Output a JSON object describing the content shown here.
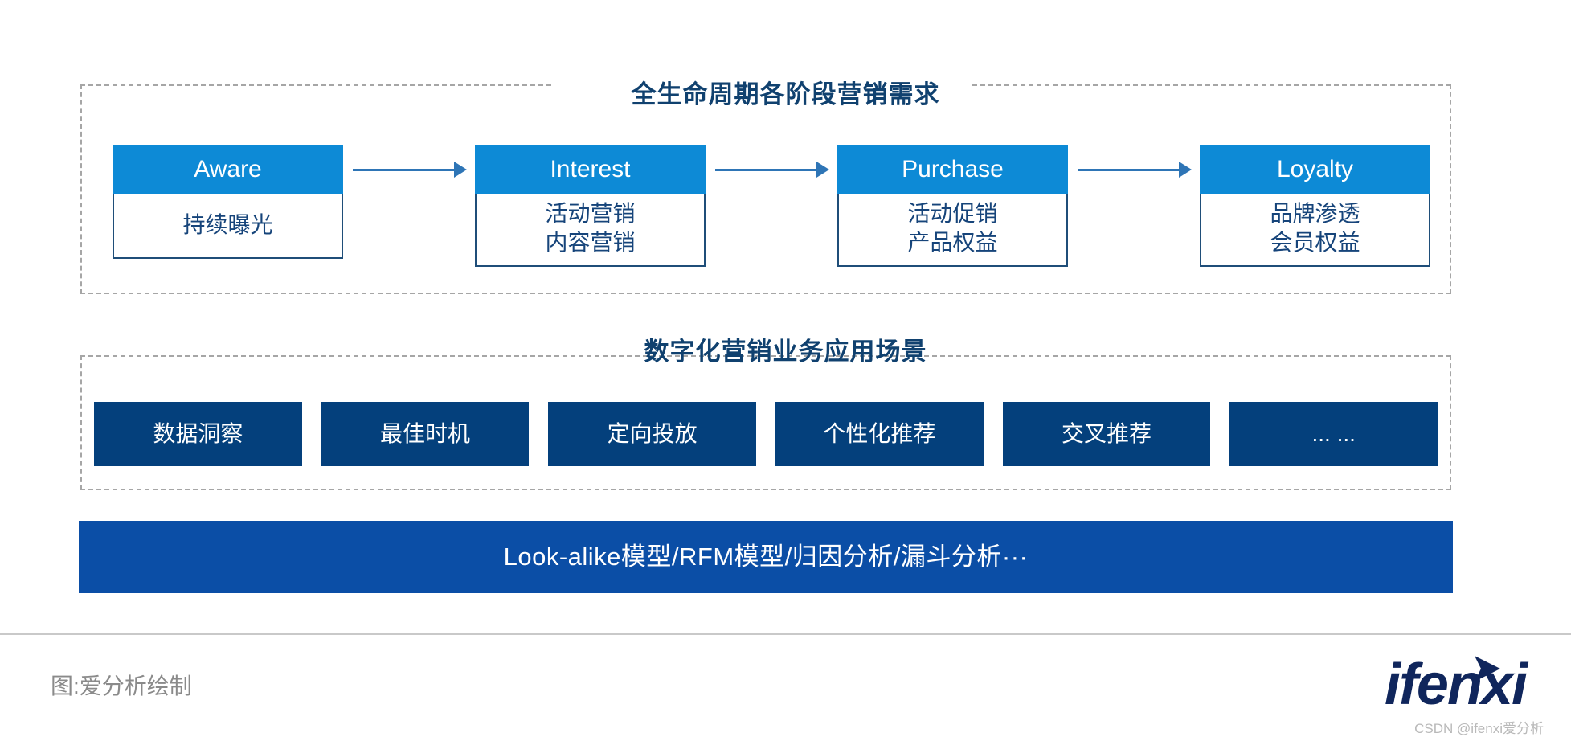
{
  "lifecycle": {
    "title": "全生命周期各阶段营销需求",
    "stages": [
      {
        "name": "Aware",
        "details": [
          "持续曝光"
        ]
      },
      {
        "name": "Interest",
        "details": [
          "活动营销",
          "内容营销"
        ]
      },
      {
        "name": "Purchase",
        "details": [
          "活动促销",
          "产品权益"
        ]
      },
      {
        "name": "Loyalty",
        "details": [
          "品牌渗透",
          "会员权益"
        ]
      }
    ]
  },
  "scenarios": {
    "title": "数字化营销业务应用场景",
    "items": [
      "数据洞察",
      "最佳时机",
      "定向投放",
      "个性化推荐",
      "交叉推荐",
      "... ..."
    ]
  },
  "models_bar": {
    "label": "Look-alike模型/RFM模型/归因分析/漏斗分析···"
  },
  "footer": {
    "caption": "图:爱分析绘制",
    "brand": "ifenxi",
    "watermark": "CSDN @ifenxi爱分析"
  },
  "colors": {
    "stage_header_blue": "#0d8ad6",
    "stage_text_navy": "#16447a",
    "scenario_navy": "#04407c",
    "models_bar_blue": "#0b4ea6",
    "title_navy": "#10416f",
    "dashed_border_gray": "#a6a6a6",
    "arrow_blue": "#2e75b6",
    "footer_gray": "#8a8a8a",
    "brand_navy": "#10265c"
  }
}
